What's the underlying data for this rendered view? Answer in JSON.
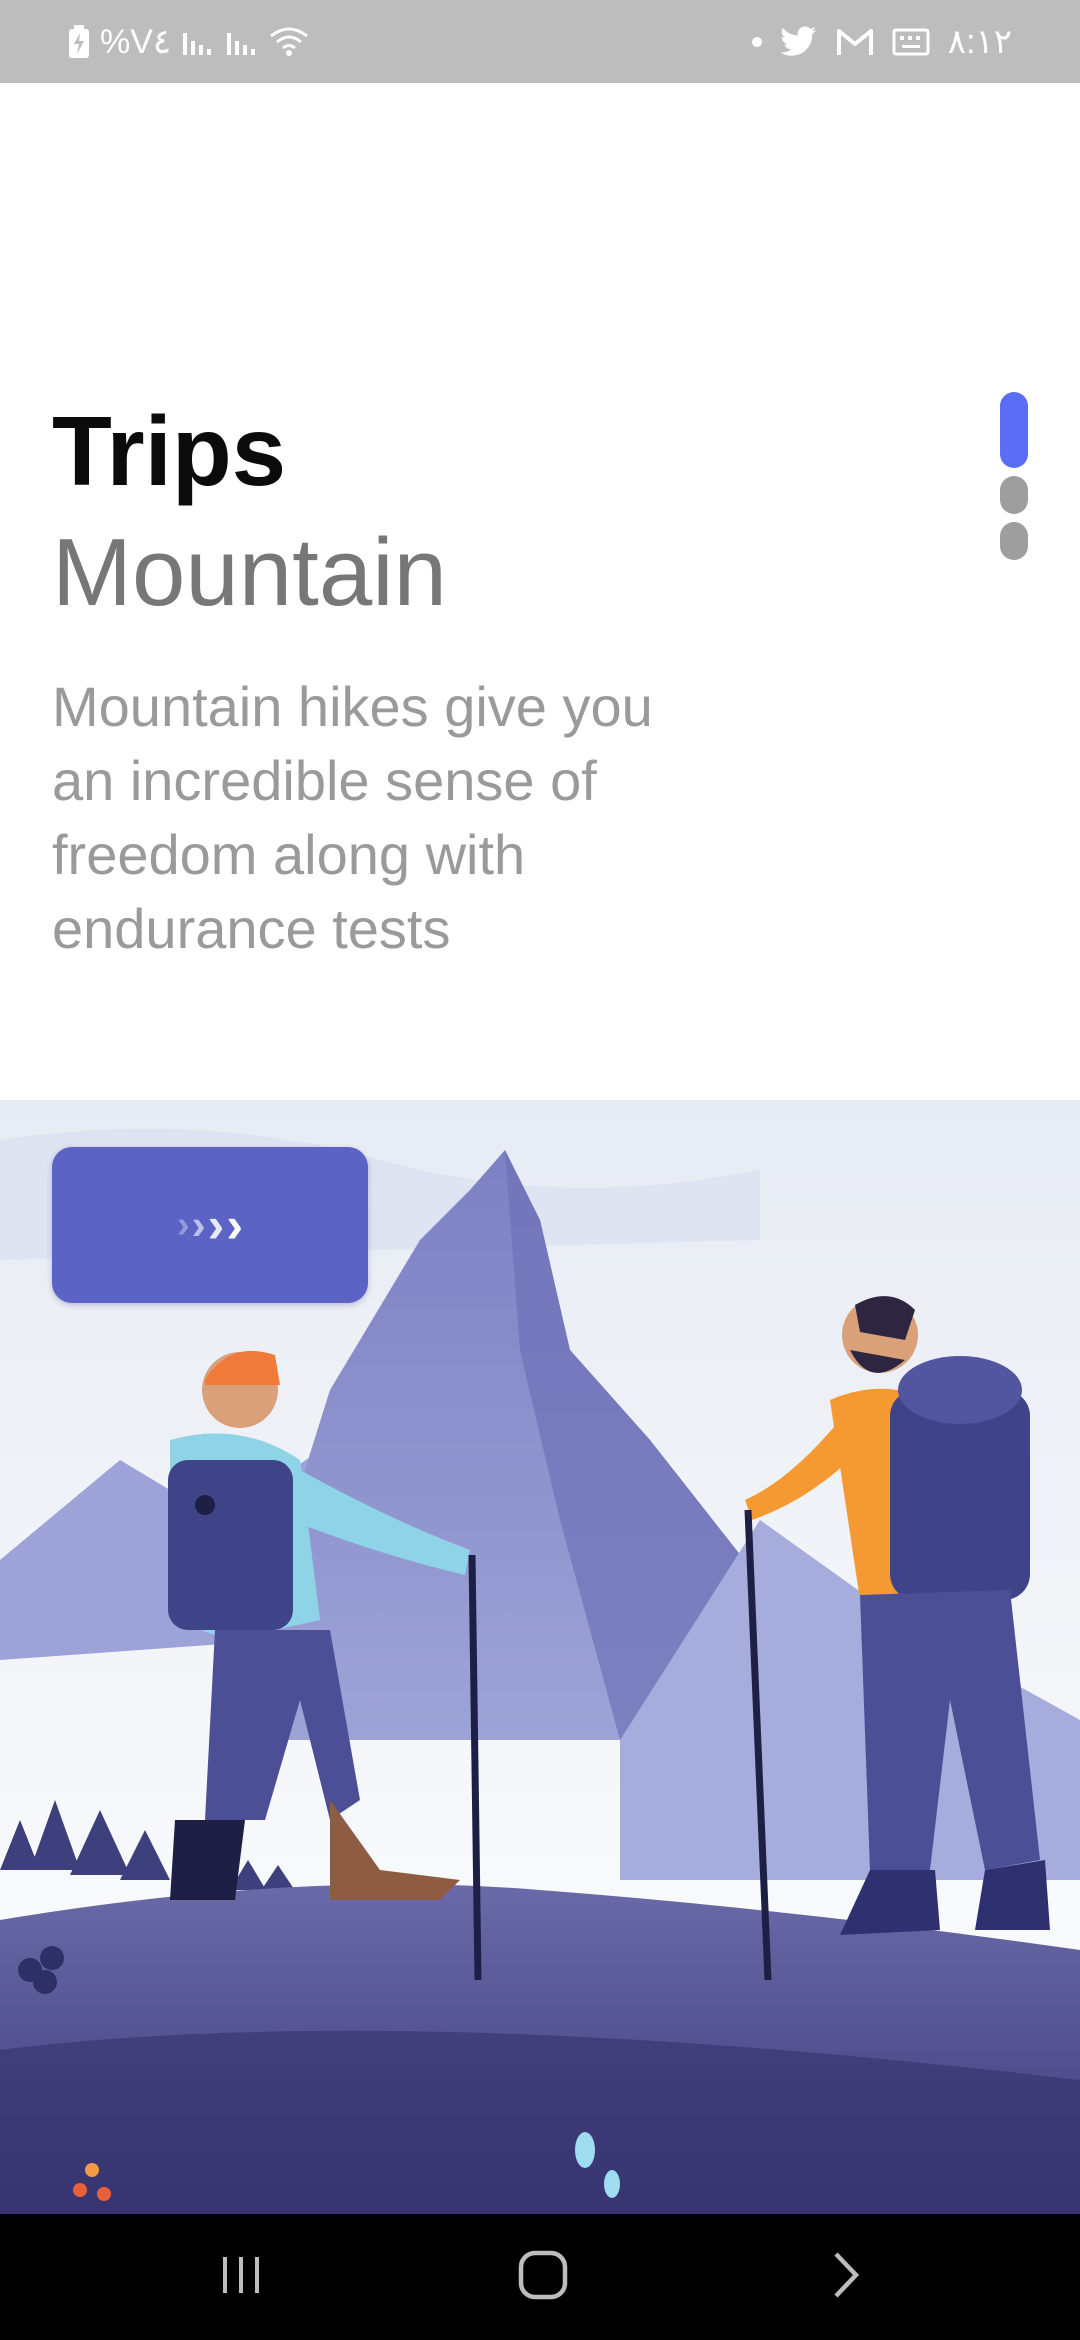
{
  "status_bar": {
    "left_text": "%V٤",
    "time": "٨:١٢"
  },
  "screen": {
    "title_bold": "Trips",
    "title_light": "Mountain",
    "description": "Mountain hikes give you an incredible sense of freedom along with endurance tests",
    "next_button_chevrons": [
      "›",
      "›",
      "›",
      "›"
    ]
  },
  "page_indicator": {
    "total": 3,
    "active_index": 0
  },
  "colors": {
    "accent": "#5b63c5",
    "indicator_active": "#5b6cf7",
    "indicator_inactive": "#9e9e9e",
    "status_bar_bg": "#bdbdbd"
  },
  "icons": {
    "status_left": [
      "battery-charging-icon",
      "signal-icon",
      "signal-icon",
      "wifi-icon"
    ],
    "status_right": [
      "notification-dot-icon",
      "twitter-icon",
      "gmail-icon",
      "keyboard-icon"
    ],
    "nav": [
      "recents-icon",
      "home-icon",
      "back-icon"
    ]
  }
}
